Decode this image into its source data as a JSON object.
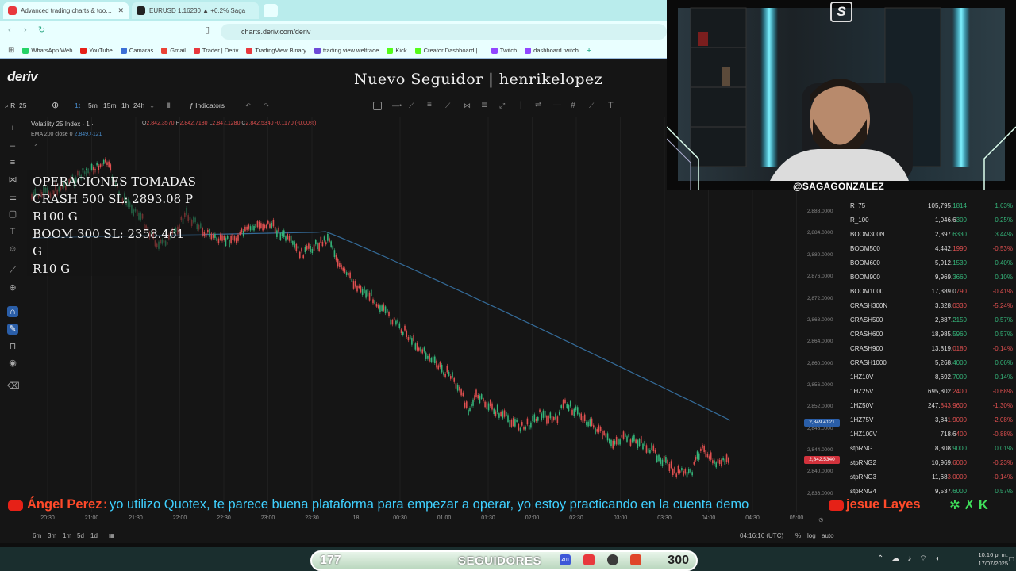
{
  "browser": {
    "tabs": [
      {
        "title": "Advanced trading charts & too…",
        "active": true
      },
      {
        "title": "EURUSD 1.16230 ▲ +0.2% Saga",
        "active": false
      }
    ],
    "address": "charts.deriv.com/deriv",
    "bookmarks": [
      "WhatsApp Web",
      "YouTube",
      "Camaras",
      "Gmail",
      "Trader | Deriv",
      "TradingView Binary",
      "trading view weltrade",
      "Kick",
      "Creator Dashboard |…",
      "Twitch",
      "dashboard twitch"
    ]
  },
  "app": {
    "logo": "deriv",
    "symbol_search": "R_25",
    "timeframes": [
      "1t",
      "5m",
      "15m",
      "1h",
      "24h"
    ],
    "indicators_label": "Indicators",
    "chart_title": "Volatility 25 Index · 1 ·",
    "ohlc": {
      "o": "2,842.3570",
      "h": "2,842.7180",
      "l": "2,842.1280",
      "c": "2,842.5340",
      "change": "-0.1170 (-0.00%)"
    },
    "ema_label": "EMA 200 close 0",
    "ema_value": "2,849.4121",
    "y_labels": [
      "2,888.0000",
      "2,884.0000",
      "2,880.0000",
      "2,876.0000",
      "2,872.0000",
      "2,868.0000",
      "2,864.0000",
      "2,860.0000",
      "2,856.0000",
      "2,852.0000",
      "2,848.0000",
      "2,844.0000",
      "2,840.0000",
      "2,836.0000"
    ],
    "ema_tag": "2,849.4121",
    "price_tag": "2,842.5340",
    "x_labels": [
      "20:30",
      "21:00",
      "21:30",
      "22:00",
      "22:30",
      "23:00",
      "23:30",
      "18",
      "00:30",
      "01:00",
      "01:30",
      "02:00",
      "02:30",
      "03:00",
      "03:30",
      "04:00",
      "04:30",
      "05:00"
    ],
    "ranges": [
      "6m",
      "3m",
      "1m",
      "5d",
      "1d"
    ],
    "clock": "04:16:16 (UTC)",
    "scale_options": [
      "%",
      "log",
      "auto"
    ]
  },
  "overlay": {
    "new_follower": "Nuevo Seguidor | henrikelopez",
    "operations": [
      "OPERACIONES TOMADAS",
      "CRASH 500 SL: 2893.08 P",
      "R100 G",
      "BOOM 300 SL: 2358.461 G",
      "R10 G"
    ],
    "cam_name": "@SAGAGONZALEZ",
    "cam_logo": "S",
    "chat": {
      "name": "Ángel Perez",
      "message": "yo utilizo Quotex, te parece buena plataforma para empezar a operar, yo estoy practicando en la cuenta demo",
      "next_name": "jesue Layes"
    },
    "followers_current": "177",
    "followers_label": "SEGUIDORES",
    "followers_goal": "300"
  },
  "watchlist": [
    {
      "symbol": "R_75",
      "price_a": "105,795",
      "price_b": ".1814",
      "change": "1.63%",
      "up": true
    },
    {
      "symbol": "R_100",
      "price_a": "1,046.6",
      "price_b": "300",
      "change": "0.25%",
      "up": true
    },
    {
      "symbol": "BOOM300N",
      "price_a": "2,397.",
      "price_b": "6330",
      "change": "3.44%",
      "up": true
    },
    {
      "symbol": "BOOM500",
      "price_a": "4,442.",
      "price_b": "1990",
      "change": "-0.53%",
      "up": false
    },
    {
      "symbol": "BOOM600",
      "price_a": "5,912.",
      "price_b": "1530",
      "change": "0.40%",
      "up": true
    },
    {
      "symbol": "BOOM900",
      "price_a": "9,969.",
      "price_b": "3660",
      "change": "0.10%",
      "up": true
    },
    {
      "symbol": "BOOM1000",
      "price_a": "17,389.0",
      "price_b": "790",
      "change": "-0.41%",
      "up": false
    },
    {
      "symbol": "CRASH300N",
      "price_a": "3,328.",
      "price_b": "0330",
      "change": "-5.24%",
      "up": false
    },
    {
      "symbol": "CRASH500",
      "price_a": "2,887.",
      "price_b": "2150",
      "change": "0.57%",
      "up": true
    },
    {
      "symbol": "CRASH600",
      "price_a": "18,985.",
      "price_b": "5960",
      "change": "0.57%",
      "up": true
    },
    {
      "symbol": "CRASH900",
      "price_a": "13,819.",
      "price_b": "0180",
      "change": "-0.14%",
      "up": false
    },
    {
      "symbol": "CRASH1000",
      "price_a": "5,268.",
      "price_b": "4000",
      "change": "0.06%",
      "up": true
    },
    {
      "symbol": "1HZ10V",
      "price_a": "8,692.",
      "price_b": "7000",
      "change": "0.14%",
      "up": true
    },
    {
      "symbol": "1HZ25V",
      "price_a": "695,802",
      "price_b": ".2400",
      "change": "-0.68%",
      "up": false
    },
    {
      "symbol": "1HZ50V",
      "price_a": "247,",
      "price_b": "843.9600",
      "change": "-1.30%",
      "up": false
    },
    {
      "symbol": "1HZ75V",
      "price_a": "3,84",
      "price_b": "1.9000",
      "change": "-2.08%",
      "up": false
    },
    {
      "symbol": "1HZ100V",
      "price_a": "718.6",
      "price_b": "400",
      "change": "-0.88%",
      "up": false
    },
    {
      "symbol": "stpRNG",
      "price_a": "8,308.",
      "price_b": "9000",
      "change": "0.01%",
      "up": true
    },
    {
      "symbol": "stpRNG2",
      "price_a": "10,969.",
      "price_b": "6000",
      "change": "-0.23%",
      "up": false
    },
    {
      "symbol": "stpRNG3",
      "price_a": "11,68",
      "price_b": "3.0000",
      "change": "-0.14%",
      "up": false
    },
    {
      "symbol": "stpRNG4",
      "price_a": "9,537.",
      "price_b": "6000",
      "change": "0.57%",
      "up": true
    }
  ],
  "taskbar": {
    "time": "10:16 p. m.",
    "date": "17/07/2025"
  },
  "colors": {
    "accent": "#2a5ea8",
    "up": "#35b57a",
    "down": "#e05050",
    "ema": "#3f88c5",
    "chat_name": "#ff4a2a",
    "chat_msg": "#3fd0ff"
  }
}
